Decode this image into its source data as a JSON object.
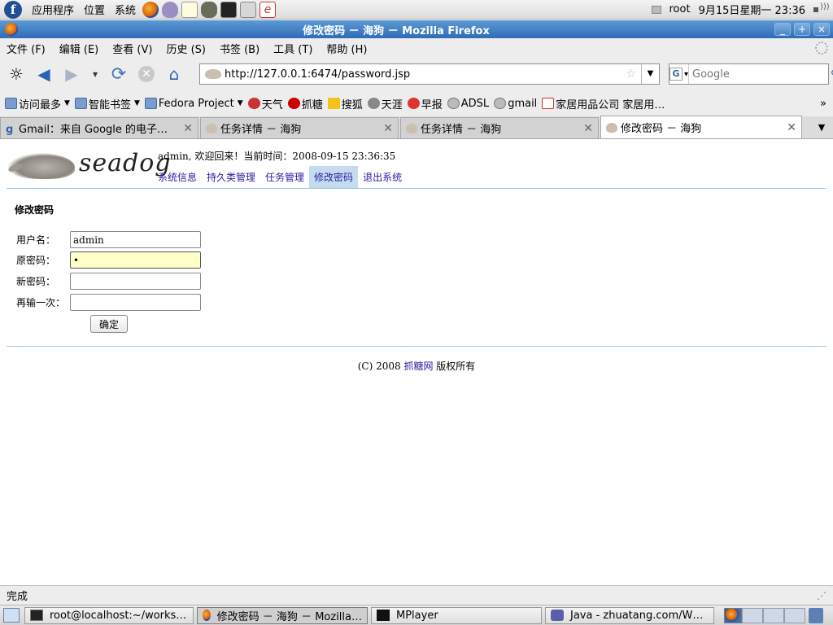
{
  "top_panel": {
    "menus": [
      "应用程序",
      "位置",
      "系统"
    ],
    "user": "root",
    "datetime": "9月15日星期一 23:36"
  },
  "window": {
    "title": "修改密码 － 海狗 － Mozilla Firefox",
    "minimize": "_",
    "maximize": "+",
    "close": "×"
  },
  "menu_bar": [
    "文件 (F)",
    "编辑 (E)",
    "查看 (V)",
    "历史 (S)",
    "书签 (B)",
    "工具 (T)",
    "帮助 (H)"
  ],
  "nav": {
    "url": "http://127.0.0.1:6474/password.jsp",
    "search_placeholder": "Google"
  },
  "bookmarks": [
    {
      "label": "访问最多",
      "icon": "folder-icon",
      "menu": true
    },
    {
      "label": "智能书签",
      "icon": "folder-icon",
      "menu": true
    },
    {
      "label": "Fedora Project",
      "icon": "folder-icon",
      "menu": true
    },
    {
      "label": "天气",
      "icon": "weather-icon",
      "menu": false
    },
    {
      "label": "抓糖",
      "icon": "zhuatang-icon",
      "menu": false
    },
    {
      "label": "搜狐",
      "icon": "sohu-icon",
      "menu": false
    },
    {
      "label": "天涯",
      "icon": "tianya-icon",
      "menu": false
    },
    {
      "label": "早报",
      "icon": "zaobao-icon",
      "menu": false
    },
    {
      "label": "ADSL",
      "icon": "globe-icon",
      "menu": false
    },
    {
      "label": "gmail",
      "icon": "globe-icon",
      "menu": false
    },
    {
      "label": "家居用品公司 家居用…",
      "icon": "home-icon",
      "menu": false
    }
  ],
  "bookmarks_more": "»",
  "tabs": [
    {
      "label": "Gmail：来自 Google 的电子…",
      "active": false
    },
    {
      "label": "任务详情 － 海狗",
      "active": false
    },
    {
      "label": "任务详情 － 海狗",
      "active": false
    },
    {
      "label": "修改密码 － 海狗",
      "active": true
    }
  ],
  "page": {
    "logo_text": "seadog",
    "welcome": "admin, 欢迎回来！当前时间：2008-09-15 23:36:35",
    "nav_links": [
      "系统信息",
      "持久类管理",
      "任务管理",
      "修改密码",
      "退出系统"
    ],
    "current_nav": "修改密码",
    "section_title": "修改密码",
    "form": {
      "username_label": "用户名：",
      "username_value": "admin",
      "old_password_label": "原密码：",
      "old_password_value": "•",
      "new_password_label": "新密码：",
      "new_password_value": "",
      "confirm_label": "再输一次：",
      "confirm_value": "",
      "submit_label": "确定"
    },
    "footer_prefix": "(C) 2008",
    "footer_link": "抓糖网",
    "footer_suffix": "版权所有"
  },
  "status": "完成",
  "taskbar": [
    {
      "label": "root@localhost:~/works…",
      "icon": "terminal-icon",
      "active": false
    },
    {
      "label": "修改密码 － 海狗 － Mozilla…",
      "icon": "firefox-icon",
      "active": true
    },
    {
      "label": "MPlayer",
      "icon": "mplayer-icon",
      "active": false
    },
    {
      "label": "Java - zhuatang.com/W…",
      "icon": "java-icon",
      "active": false
    }
  ]
}
